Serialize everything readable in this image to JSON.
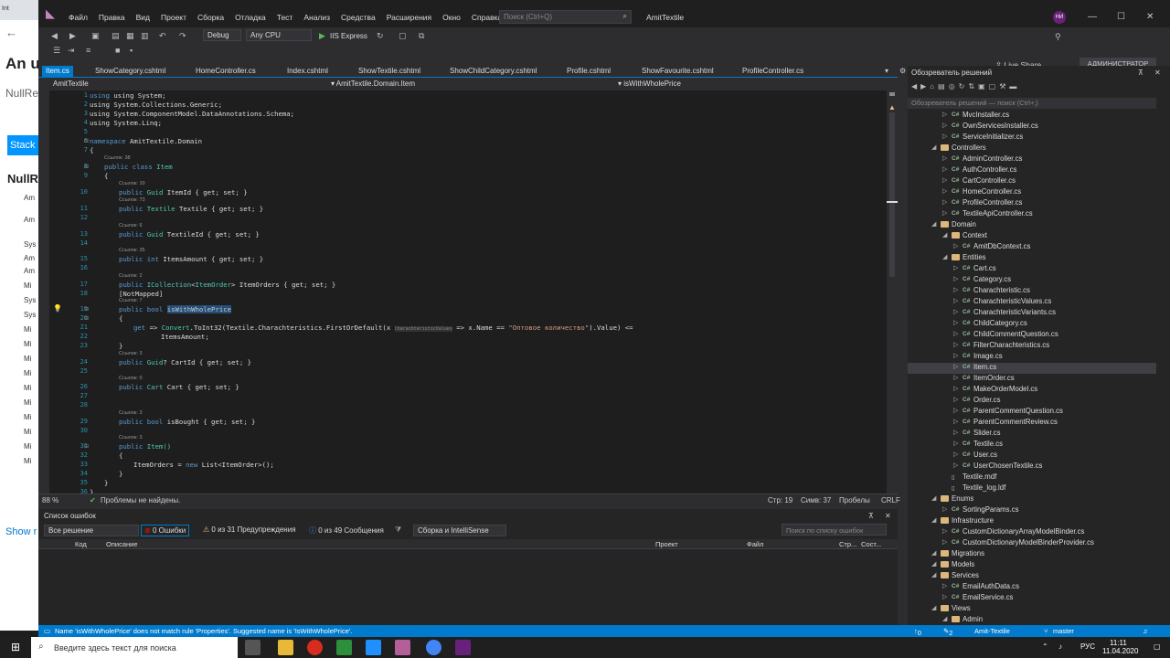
{
  "browser": {
    "tab": "Int",
    "title": "An u",
    "subtitle": "NullRe",
    "lines": [
      "Am",
      "Am",
      "Sys",
      "Am",
      "Am",
      "Mi",
      "Sys",
      "Sys",
      "Mi",
      "Mi",
      "Mi",
      "Mi",
      "Mi",
      "Mi",
      "Mi",
      "Mi",
      "Mi",
      "Mi"
    ],
    "so": "Stack",
    "null_title": "NullR",
    "link": "Show r"
  },
  "titlebar": {
    "menu": [
      "Файл",
      "Правка",
      "Вид",
      "Проект",
      "Сборка",
      "Отладка",
      "Тест",
      "Анализ",
      "Средства",
      "Расширения",
      "Окно",
      "Справка"
    ],
    "search_placeholder": "Поиск (Ctrl+Q)",
    "solution": "AmitTextile",
    "avatar": "НИ"
  },
  "toolbar": {
    "config": "Debug",
    "platform": "Any CPU",
    "run": "IIS Express",
    "liveshare": "Live Share",
    "admin": "АДМИНИСТРАТОР"
  },
  "tabs": [
    "Item.cs",
    "ShowCategory.cshtml",
    "HomeController.cs",
    "Index.cshtml",
    "ShowTextile.cshtml",
    "ShowChildCategory.cshtml",
    "Profile.cshtml",
    "ShowFavourite.cshtml",
    "ProfileController.cs"
  ],
  "navbar": {
    "project": "AmitTextile",
    "class": "AmitTextile.Domain.Item",
    "member": "isWithWholePrice"
  },
  "code": {
    "using1": "using System;",
    "using2": "using System.Collections.Generic;",
    "using3": "using System.ComponentModel.DataAnnotations.Schema;",
    "using4": "using System.Linq;",
    "ns": "AmitTextile.Domain",
    "ref38": "Ссылок: 38",
    "cls": "Item",
    "r10": "Ссылок: 10",
    "p1": "ItemId { get; set; }",
    "r73": "Ссылок: 73",
    "p2": "Textile { get; set; }",
    "r6": "Ссылок: 6",
    "p3": "TextileId { get; set; }",
    "r35": "Ссылок: 35",
    "p4": "ItemsAmount { get; set; }",
    "r2": "Ссылок: 2",
    "p5": "ItemOrders { get; set; }",
    "attr": "[NotMapped]",
    "r7": "Ссылок: 7",
    "p6name": "isWithWholePrice",
    "getline": "ToInt32(Textile.Charachteristics.FirstOrDefault(",
    "hint": "CharachteristicValues",
    "arrow": "=> x.Name ==",
    "lit": "\"Оптовое количество\"",
    "tail": ").Value) <=",
    "items": "ItemsAmount;",
    "r3": "Ссылок: 3",
    "p7": "CartId { get; set; }",
    "r0": "Ссылок: 0",
    "p8": "Cart { get; set; }",
    "r3b": "Ссылок: 3",
    "p9": "isBought { get; set; }",
    "r3c": "Ссылок: 3",
    "ctor": "Item()",
    "ctorbody": "ItemOrders = ",
    "ctornew": "List<ItemOrder>();"
  },
  "editor_status": {
    "zoom": "88 %",
    "problems": "Проблемы не найдены.",
    "line": "Стр: 19",
    "char": "Симв: 37",
    "spaces": "Пробелы",
    "eol": "CRLF"
  },
  "errlist": {
    "title": "Список ошибок",
    "scope": "Все решение",
    "errors": "0 Ошибки",
    "warnings": "0 из 31 Предупреждения",
    "messages": "0 из 49 Сообщения",
    "build": "Сборка и IntelliSense",
    "search": "Поиск по списку ошибок",
    "cols": [
      "Код",
      "Описание",
      "Проект",
      "Файл",
      "Стр...",
      "Сост..."
    ]
  },
  "solution": {
    "title": "Обозреватель решений",
    "search": "Обозреватель решений — поиск (Ctrl+;)",
    "tree": [
      {
        "t": "MvcInstaller.cs",
        "k": "cs",
        "d": 3
      },
      {
        "t": "OwnServicesInstaller.cs",
        "k": "cs",
        "d": 3
      },
      {
        "t": "ServiceInitializer.cs",
        "k": "cs",
        "d": 3
      },
      {
        "t": "Controllers",
        "k": "folder",
        "d": 2
      },
      {
        "t": "AdminController.cs",
        "k": "cs",
        "d": 3
      },
      {
        "t": "AuthController.cs",
        "k": "cs",
        "d": 3
      },
      {
        "t": "CartController.cs",
        "k": "cs",
        "d": 3
      },
      {
        "t": "HomeController.cs",
        "k": "cs",
        "d": 3
      },
      {
        "t": "ProfileController.cs",
        "k": "cs",
        "d": 3
      },
      {
        "t": "TextileApiController.cs",
        "k": "cs",
        "d": 3
      },
      {
        "t": "Domain",
        "k": "folder",
        "d": 2
      },
      {
        "t": "Context",
        "k": "folder",
        "d": 3
      },
      {
        "t": "AmitDbContext.cs",
        "k": "cs",
        "d": 4
      },
      {
        "t": "Entities",
        "k": "folder",
        "d": 3
      },
      {
        "t": "Cart.cs",
        "k": "cs",
        "d": 4
      },
      {
        "t": "Category.cs",
        "k": "cs",
        "d": 4
      },
      {
        "t": "Charachteristic.cs",
        "k": "cs",
        "d": 4
      },
      {
        "t": "CharachteristicValues.cs",
        "k": "cs",
        "d": 4
      },
      {
        "t": "CharachteristicVariants.cs",
        "k": "cs",
        "d": 4
      },
      {
        "t": "ChildCategory.cs",
        "k": "cs",
        "d": 4
      },
      {
        "t": "ChildCommentQuestion.cs",
        "k": "cs",
        "d": 4
      },
      {
        "t": "FilterCharachteristics.cs",
        "k": "cs",
        "d": 4
      },
      {
        "t": "Image.cs",
        "k": "cs",
        "d": 4
      },
      {
        "t": "Item.cs",
        "k": "cs",
        "d": 4
      },
      {
        "t": "ItemOrder.cs",
        "k": "cs",
        "d": 4
      },
      {
        "t": "MakeOrderModel.cs",
        "k": "cs",
        "d": 4
      },
      {
        "t": "Order.cs",
        "k": "cs",
        "d": 4
      },
      {
        "t": "ParentCommentQuestion.cs",
        "k": "cs",
        "d": 4
      },
      {
        "t": "ParentCommentReview.cs",
        "k": "cs",
        "d": 4
      },
      {
        "t": "Slider.cs",
        "k": "cs",
        "d": 4
      },
      {
        "t": "Textile.cs",
        "k": "cs",
        "d": 4
      },
      {
        "t": "User.cs",
        "k": "cs",
        "d": 4
      },
      {
        "t": "UserChosenTextile.cs",
        "k": "cs",
        "d": 4
      },
      {
        "t": "Textile.mdf",
        "k": "db",
        "d": 3
      },
      {
        "t": "Textile_log.ldf",
        "k": "db",
        "d": 3
      },
      {
        "t": "Enums",
        "k": "folder",
        "d": 2
      },
      {
        "t": "SortingParams.cs",
        "k": "cs",
        "d": 3
      },
      {
        "t": "Infrastructure",
        "k": "folder",
        "d": 2
      },
      {
        "t": "CustomDictionaryArrayModelBinder.cs",
        "k": "cs",
        "d": 3
      },
      {
        "t": "CustomDictionaryModelBinderProvider.cs",
        "k": "cs",
        "d": 3
      },
      {
        "t": "Migrations",
        "k": "folder",
        "d": 2
      },
      {
        "t": "Models",
        "k": "folder",
        "d": 2
      },
      {
        "t": "Services",
        "k": "folder",
        "d": 2
      },
      {
        "t": "EmailAuthData.cs",
        "k": "cs",
        "d": 3
      },
      {
        "t": "EmailService.cs",
        "k": "cs",
        "d": 3
      },
      {
        "t": "Views",
        "k": "folder",
        "d": 2
      },
      {
        "t": "Admin",
        "k": "folder",
        "d": 3
      }
    ]
  },
  "bottom": {
    "message": "Name 'isWithWholePrice' does not match rule 'Properties'. Suggested name is 'IsWithWholePrice'.",
    "up": "0",
    "pen": "2",
    "repo": "Amit-Textile",
    "branch": "master"
  },
  "taskbar": {
    "search": "Введите здесь текст для поиска",
    "lang": "РУС",
    "time": "11:11",
    "date": "11.04.2020"
  }
}
